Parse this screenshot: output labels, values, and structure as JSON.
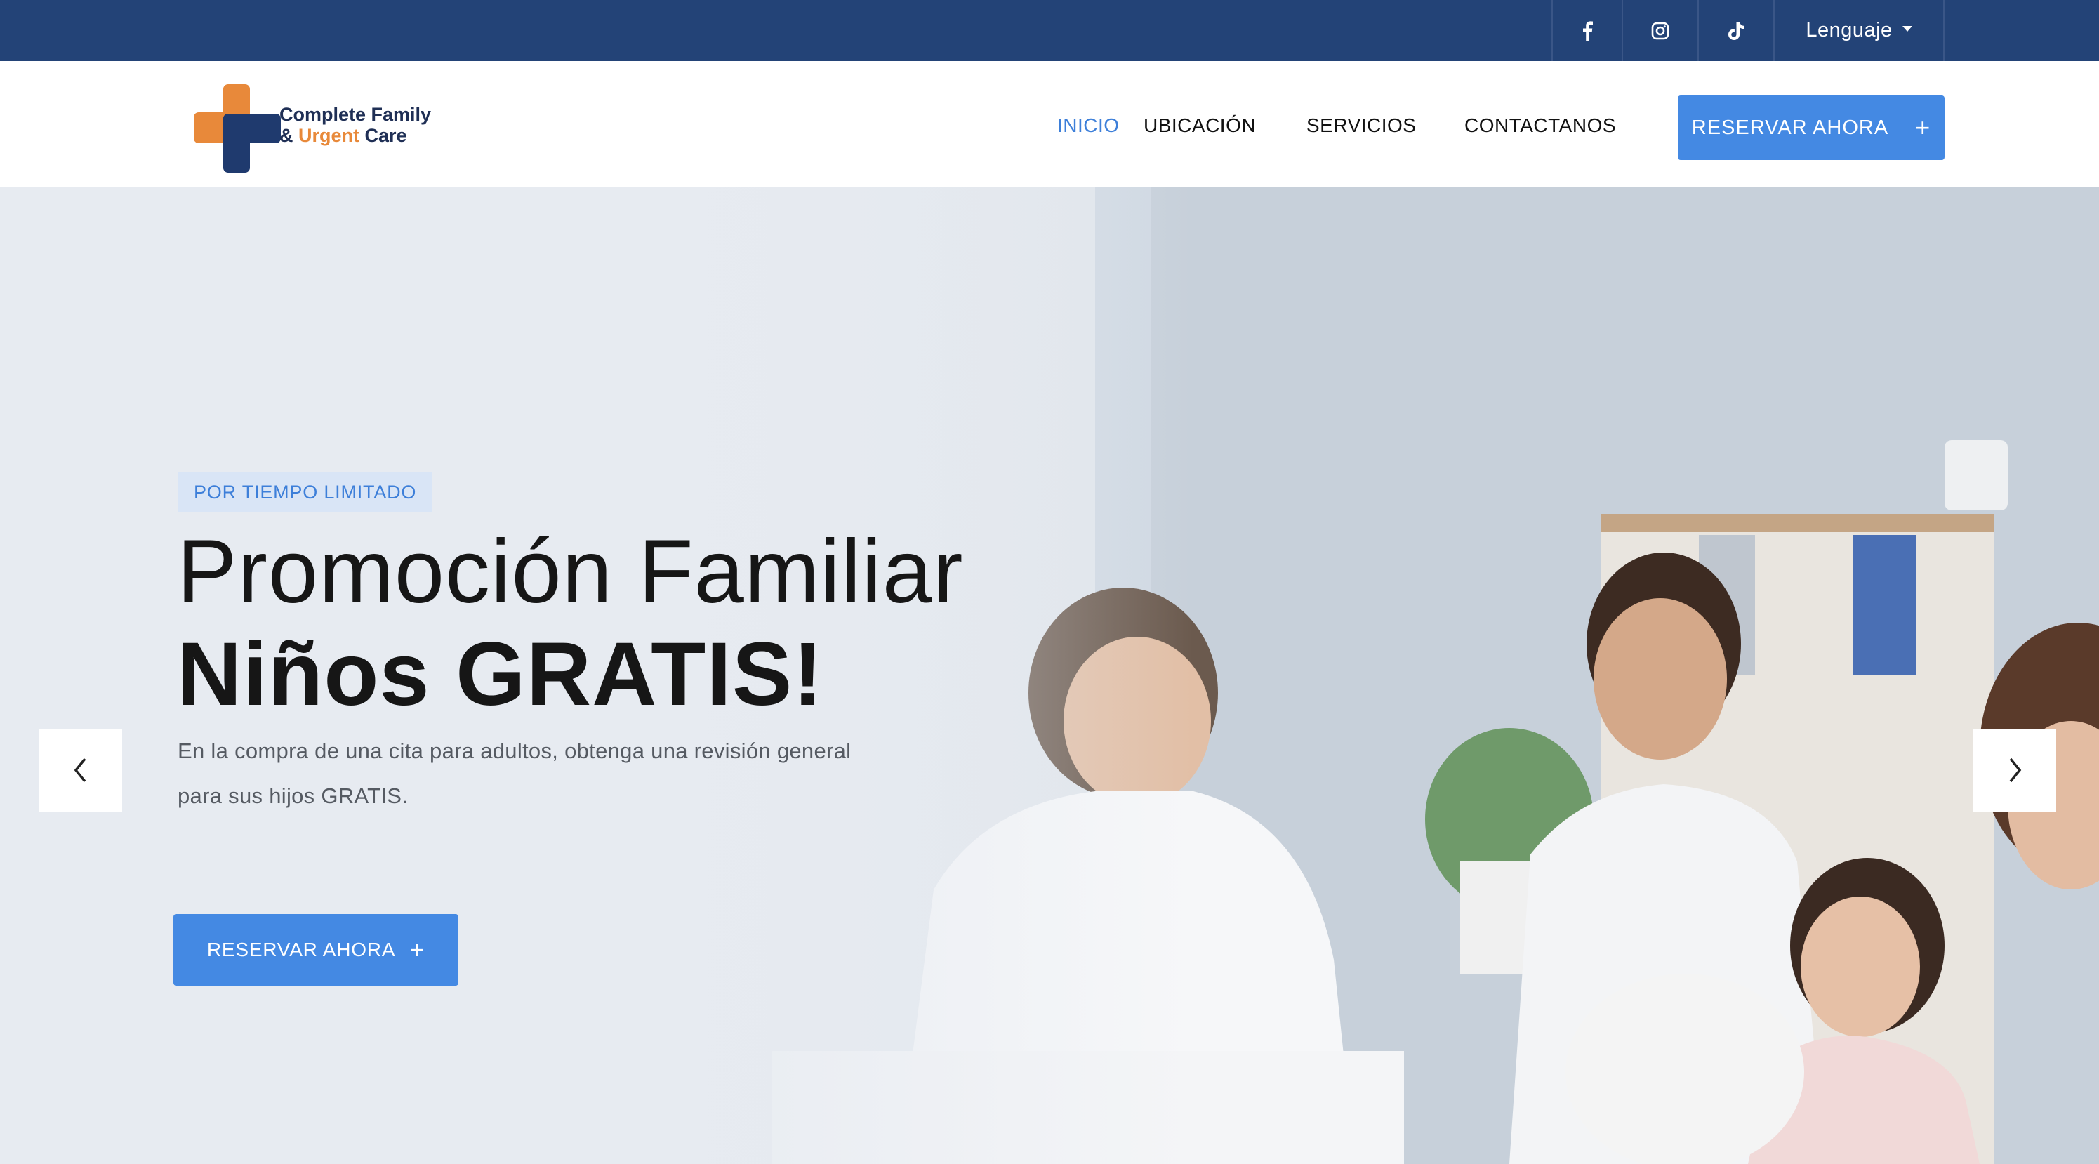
{
  "topbar": {
    "social": [
      {
        "icon": "facebook-icon"
      },
      {
        "icon": "instagram-icon"
      },
      {
        "icon": "tiktok-icon"
      }
    ],
    "language_label": "Lenguaje"
  },
  "header": {
    "logo": {
      "line1": "Complete Family",
      "amp": "& ",
      "urgent": "Urgent",
      "care": " Care"
    },
    "nav": [
      "INICIO",
      "UBICACIÓN",
      "SERVICIOS",
      "CONTACTANOS"
    ],
    "cta_label": "RESERVAR AHORA",
    "cta_icon": "+"
  },
  "hero": {
    "badge": "POR TIEMPO LIMITADO",
    "title_line1": "Promoción Familiar",
    "title_line2": "Niños GRATIS!",
    "description": "En la compra de una cita para adultos, obtenga una revisión general para sus hijos GRATIS.",
    "cta_label": "RESERVAR AHORA",
    "cta_icon": "+"
  },
  "colors": {
    "topbar": "#234377",
    "accent": "#4489e3",
    "active_nav": "#3d7fd9",
    "logo_orange": "#e8893a",
    "logo_navy": "#1f3a6e"
  }
}
